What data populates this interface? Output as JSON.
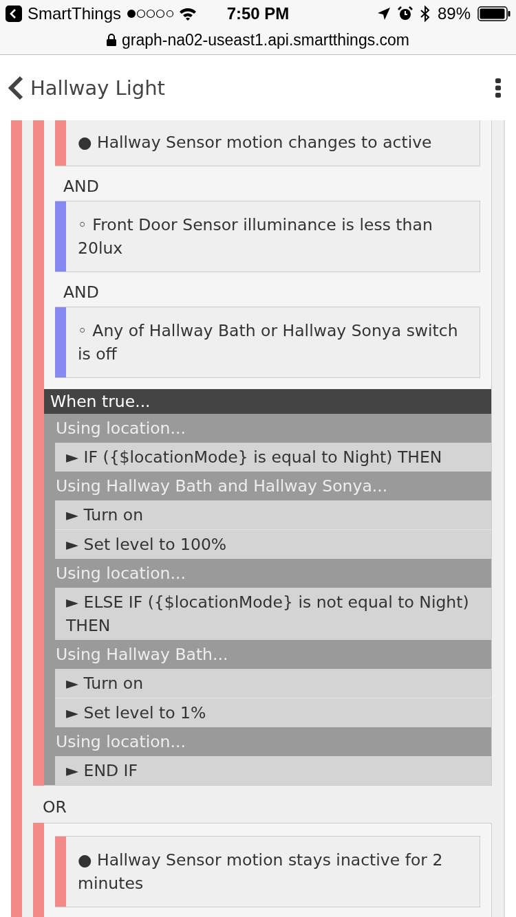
{
  "status_bar": {
    "back_label": "SmartThings",
    "time": "7:50 PM",
    "battery": "89%"
  },
  "address_bar": {
    "url": "graph-na02-useast1.api.smartthings.com"
  },
  "header": {
    "title": "Hallway Light"
  },
  "blocks": [
    {
      "kind": "group",
      "items": [
        {
          "kind": "condition",
          "text": "● Hallway Sensor motion changes to active",
          "color": "#f28b88"
        },
        {
          "kind": "operator",
          "text": "AND"
        },
        {
          "kind": "condition",
          "text": "◦ Front Door Sensor illuminance is less than 20lux",
          "color": "#8888f2"
        },
        {
          "kind": "operator",
          "text": "AND"
        },
        {
          "kind": "condition",
          "text": "◦ Any of Hallway Bath or Hallway Sonya switch is off",
          "color": "#8888f2"
        }
      ],
      "actions": {
        "label": "When true...",
        "rows": [
          {
            "kind": "using",
            "text": "Using location..."
          },
          {
            "kind": "step",
            "text": "► IF ({$locationMode} is equal to Night) THEN"
          },
          {
            "kind": "using",
            "text": "Using Hallway Bath and Hallway Sonya..."
          },
          {
            "kind": "step",
            "text": "► Turn on"
          },
          {
            "kind": "step",
            "text": "► Set level to 100%"
          },
          {
            "kind": "using",
            "text": "Using location..."
          },
          {
            "kind": "step",
            "text": "► ELSE IF ({$locationMode} is not equal to Night) THEN"
          },
          {
            "kind": "using",
            "text": "Using Hallway Bath..."
          },
          {
            "kind": "step",
            "text": "► Turn on"
          },
          {
            "kind": "step",
            "text": "► Set level to 1%"
          },
          {
            "kind": "using",
            "text": "Using location..."
          },
          {
            "kind": "step",
            "text": "► END IF"
          }
        ]
      }
    },
    {
      "kind": "operator",
      "text": "OR"
    },
    {
      "kind": "group",
      "items": [
        {
          "kind": "condition",
          "text": "● Hallway Sensor motion stays inactive for 2 minutes",
          "color": "#f28b88"
        }
      ]
    }
  ]
}
